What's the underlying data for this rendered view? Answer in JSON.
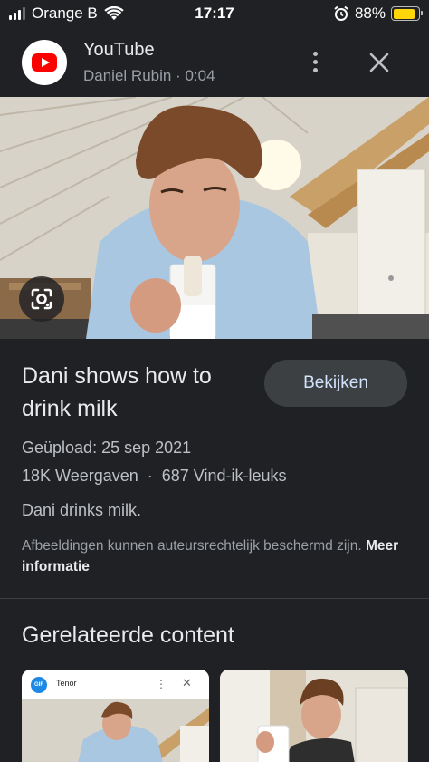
{
  "status_bar": {
    "carrier": "Orange B",
    "time": "17:17",
    "battery": "88%",
    "battery_level": 0.88,
    "icons": [
      "signal-icon",
      "wifi-icon",
      "alarm-icon",
      "battery-icon"
    ]
  },
  "source": {
    "name": "YouTube",
    "meta": "Daniel Rubin · 0:04",
    "icons": [
      "youtube-logo",
      "more-vert-icon",
      "close-icon"
    ]
  },
  "result": {
    "title": "Dani shows how to drink milk",
    "view_button": "Bekijken",
    "upload_date": "Geüpload: 25 sep 2021",
    "views": "18K Weergaven",
    "separator": "·",
    "likes": "687 Vind-ik-leuks",
    "description": "Dani drinks milk.",
    "copyright_text": "Afbeeldingen kunnen auteursrechtelijk beschermd zijn.",
    "more_info": "Meer informatie"
  },
  "related": {
    "heading": "Gerelateerde content",
    "cards": [
      {
        "source": "Tenor",
        "logo_text": "GIF"
      },
      {
        "source": ""
      }
    ]
  },
  "colors": {
    "background": "#202124",
    "button_bg": "#3c4043",
    "button_text": "#d2e3fc",
    "youtube_red": "#ff0000",
    "battery_yellow": "#ffd60a"
  }
}
